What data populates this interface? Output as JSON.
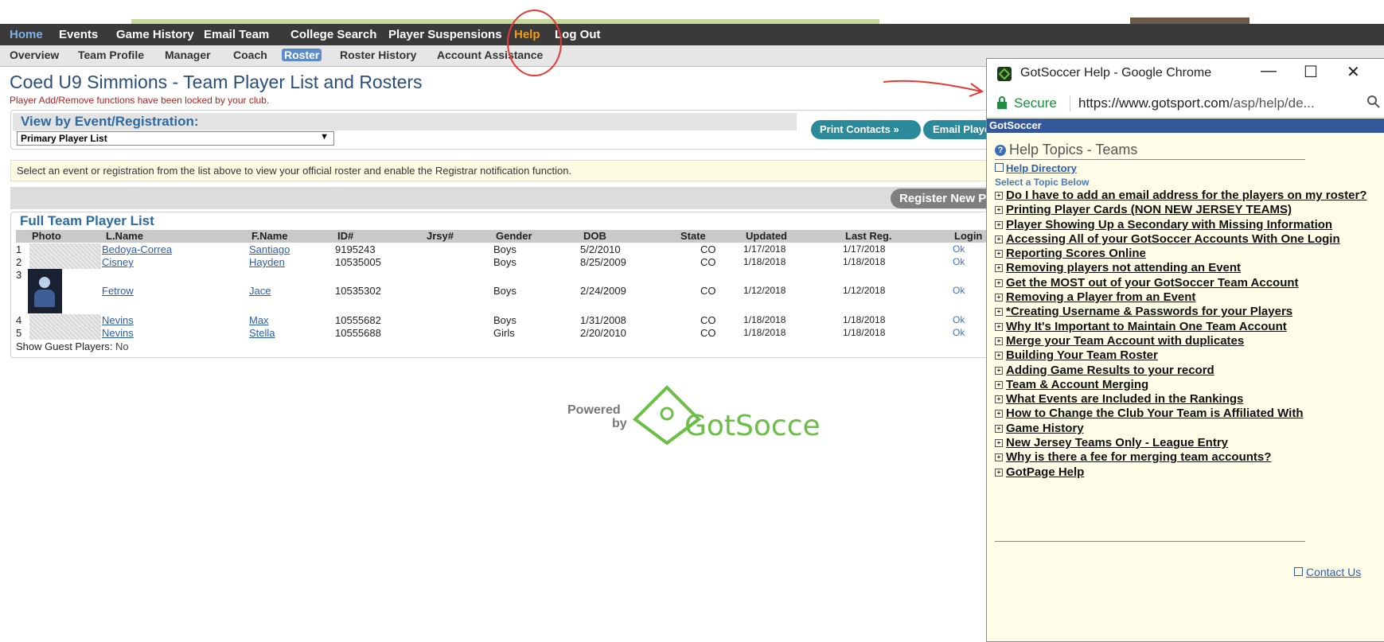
{
  "nav_primary": [
    "Home",
    "Events",
    "Game History",
    "Email Team",
    "College Search",
    "Player Suspensions",
    "Help",
    "Log Out"
  ],
  "nav_secondary": [
    "Overview",
    "Team Profile",
    "Manager",
    "Coach",
    "Roster",
    "Roster History",
    "Account Assistance"
  ],
  "page": {
    "title": "Coed U9 Simmions - Team Player List and Rosters",
    "locked_notice": "Player Add/Remove functions have been locked by your club."
  },
  "event_section": {
    "label": "View by Event/Registration:",
    "selected": "Primary Player List",
    "print_button": "Print Contacts »",
    "email_button": "Email Players »",
    "info": "Select an event or registration from the list above to view your official roster and enable the Registrar notification function.",
    "register_button": "Register New Players"
  },
  "roster": {
    "title": "Full Team Player List",
    "columns": [
      "Photo",
      "L.Name",
      "F.Name",
      "ID#",
      "Jrsy#",
      "Gender",
      "DOB",
      "State",
      "Updated",
      "Last Reg.",
      "Login"
    ],
    "rows": [
      {
        "num": "1",
        "last": "Bedoya-Correa",
        "first": "Santiago",
        "id": "9195243",
        "jersey": "",
        "gender": "Boys",
        "dob": "5/2/2010",
        "state": "CO",
        "updated": "1/17/2018",
        "last_reg": "1/17/2018",
        "login": "Ok"
      },
      {
        "num": "2",
        "last": "Cisney",
        "first": "Hayden",
        "id": "10535005",
        "jersey": "",
        "gender": "Boys",
        "dob": "8/25/2009",
        "state": "CO",
        "updated": "1/18/2018",
        "last_reg": "1/18/2018",
        "login": "Ok"
      },
      {
        "num": "3",
        "last": "Fetrow",
        "first": "Jace",
        "id": "10535302",
        "jersey": "",
        "gender": "Boys",
        "dob": "2/24/2009",
        "state": "CO",
        "updated": "1/12/2018",
        "last_reg": "1/12/2018",
        "login": "Ok"
      },
      {
        "num": "4",
        "last": "Nevins",
        "first": "Max",
        "id": "10555682",
        "jersey": "",
        "gender": "Boys",
        "dob": "1/31/2008",
        "state": "CO",
        "updated": "1/18/2018",
        "last_reg": "1/18/2018",
        "login": "Ok"
      },
      {
        "num": "5",
        "last": "Nevins",
        "first": "Stella",
        "id": "10555688",
        "jersey": "",
        "gender": "Girls",
        "dob": "2/20/2010",
        "state": "CO",
        "updated": "1/18/2018",
        "last_reg": "1/18/2018",
        "login": "Ok"
      }
    ],
    "guest_label": "Show Guest Players:",
    "guest_value": "No"
  },
  "logo": {
    "powered": "Powered",
    "by": "by",
    "brand": "GotSoccer",
    "brand_color": "#6abf45"
  },
  "popup": {
    "window_title": "GotSoccer Help - Google Chrome",
    "secure": "Secure",
    "url_host": "https://www.gotsport.com",
    "url_path": "/asp/help/de...",
    "bar_label": "GotSoccer",
    "help_title": "Help Topics - Teams",
    "directory_link": "Help Directory",
    "select_topic": "Select a Topic Below",
    "topics": [
      "Do I have to add an email address for the players on my roster?",
      "Printing Player Cards (NON NEW JERSEY TEAMS)",
      "Player Showing Up a Secondary with Missing Information",
      "Accessing All of your GotSoccer Accounts With One Login",
      "Reporting Scores Online",
      "Removing players not attending an Event",
      "Get the MOST out of your GotSoccer Team Account",
      "Removing a Player from an Event",
      "*Creating Username & Passwords for your Players",
      "Why It's Important to Maintain One Team Account",
      "Merge your Team Account with duplicates",
      "Building Your Team Roster",
      "Adding Game Results to your record",
      "Team & Account Merging",
      "What Events are Included in the Rankings",
      "How to Change the Club Your Team is Affiliated With",
      "Game History",
      "New Jersey Teams Only - League Entry",
      "Why is there a fee for merging team accounts?",
      "GotPage Help"
    ],
    "contact_link": "Contact Us"
  },
  "colors": {
    "accent": "#2a8a99",
    "help_highlight": "#f39c12",
    "annotation": "#e53935"
  }
}
